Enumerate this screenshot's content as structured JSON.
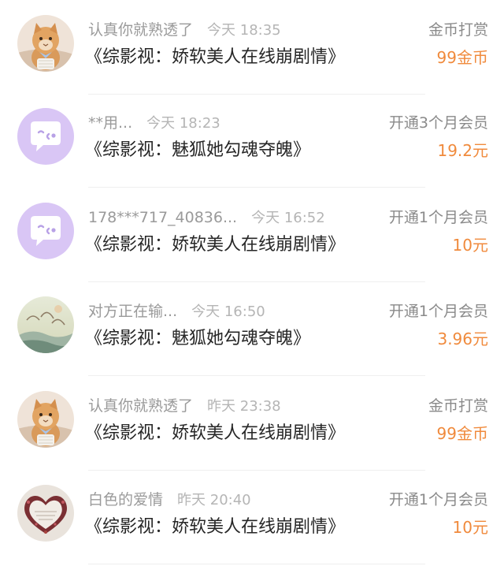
{
  "colors": {
    "username": "#9a9a9a",
    "time": "#b5b5b5",
    "title": "#262626",
    "gift_type": "#8a8a8a",
    "amount": "#f08a3c",
    "divider": "#efefef",
    "default_avatar_bg": "#d9c6f5"
  },
  "items": [
    {
      "avatar": "cat-avatar",
      "username": "认真你就熟透了",
      "time": "今天 18:35",
      "title": "《综影视：娇软美人在线崩剧情》",
      "gift_type": "金币打赏",
      "amount": "99金币"
    },
    {
      "avatar": "default-chat-avatar",
      "username": "**用...",
      "time": "今天 18:23",
      "title": "《综影视：魅狐她勾魂夺魄》",
      "gift_type": "开通3个月会员",
      "amount": "19.2元"
    },
    {
      "avatar": "default-chat-avatar",
      "username": "178***717_40836...",
      "time": "今天 16:52",
      "title": "《综影视：娇软美人在线崩剧情》",
      "gift_type": "开通1个月会员",
      "amount": "10元"
    },
    {
      "avatar": "landscape-painting-avatar",
      "username": "对方正在输...",
      "time": "今天 16:50",
      "title": "《综影视：魅狐她勾魂夺魄》",
      "gift_type": "开通1个月会员",
      "amount": "3.96元"
    },
    {
      "avatar": "cat-avatar",
      "username": "认真你就熟透了",
      "time": "昨天 23:38",
      "title": "《综影视：娇软美人在线崩剧情》",
      "gift_type": "金币打赏",
      "amount": "99金币"
    },
    {
      "avatar": "heart-flowers-avatar",
      "username": "白色的爱情",
      "time": "昨天 20:40",
      "title": "《综影视：娇软美人在线崩剧情》",
      "gift_type": "开通1个月会员",
      "amount": "10元"
    }
  ]
}
